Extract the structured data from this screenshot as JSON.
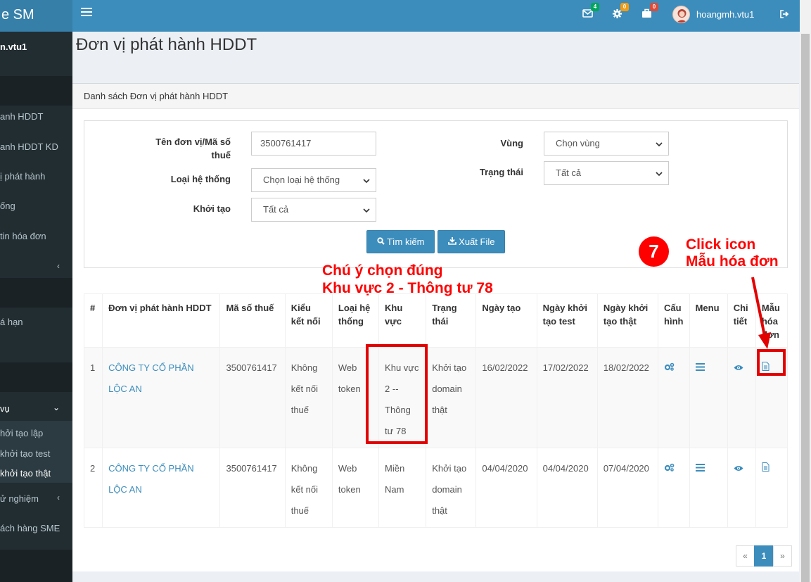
{
  "header": {
    "brand": "e SM",
    "user_name": "hoangmh.vtu1",
    "badges": {
      "mail": "4",
      "gear": "0",
      "briefcase": "0"
    },
    "badge_colors": {
      "mail": "#00a65a",
      "gear": "#f39c12",
      "briefcase": "#dd4b39"
    }
  },
  "sidebar": {
    "user": "n.vtu1",
    "items": [
      {
        "label": "anh HDDT"
      },
      {
        "label": "anh HDDT KD"
      },
      {
        "label": "ị phát hành"
      },
      {
        "label": "ống"
      },
      {
        "label": "tin hóa đơn"
      },
      {
        "label": "á hạn"
      },
      {
        "label": "vụ"
      },
      {
        "label": "hởi tạo lập"
      },
      {
        "label": "khởi tạo test"
      },
      {
        "label": "khởi tạo thật"
      },
      {
        "label": "ử nghiệm"
      },
      {
        "label": "ách hàng SME"
      }
    ]
  },
  "page": {
    "title": "Đơn vị phát hành HDDT",
    "box_title": "Danh sách Đơn vị phát hành HDDT"
  },
  "filter": {
    "tax_label": "Tên đơn vị/Mã số thuế",
    "tax_value": "3500761417",
    "system_label": "Loại hệ thống",
    "system_value": "Chọn loại hệ thống",
    "init_label": "Khởi tạo",
    "init_value": "Tất cả",
    "region_label": "Vùng",
    "region_value": "Chọn vùng",
    "status_label": "Trạng thái",
    "status_value": "Tất cả",
    "search_button": "Tìm kiếm",
    "export_button": "Xuất File"
  },
  "table": {
    "headers": [
      "#",
      "Đơn vị phát hành HDDT",
      "Mã số thuế",
      "Kiểu kết nối",
      "Loại hệ thống",
      "Khu vực",
      "Trạng thái",
      "Ngày tạo",
      "Ngày khởi tạo test",
      "Ngày khởi tạo thật",
      "Cấu hình",
      "Menu",
      "Chi tiết",
      "Mẫu hóa đơn"
    ],
    "rows": [
      {
        "num": "1",
        "name": "CÔNG TY CỔ PHẦN LỘC AN",
        "tax": "3500761417",
        "conn": "Không kết nối thuế",
        "system": "Web token",
        "region": "Khu vực 2 -- Thông tư 78",
        "status": "Khởi tạo domain thật",
        "created": "16/02/2022",
        "test_date": "17/02/2022",
        "real_date": "18/02/2022"
      },
      {
        "num": "2",
        "name": "CÔNG TY CỔ PHẦN LỘC AN",
        "tax": "3500761417",
        "conn": "Không kết nối thuế",
        "system": "Web token",
        "region": "Miền Nam",
        "status": "Khởi tạo domain thật",
        "created": "04/04/2020",
        "test_date": "04/04/2020",
        "real_date": "07/04/2020"
      }
    ]
  },
  "pagination": {
    "prev": "«",
    "current": "1",
    "next": "»"
  },
  "annotations": {
    "note_line1": "Chú ý chọn đúng",
    "note_line2": "Khu vực 2 - Thông tư 78",
    "step": "7",
    "click_line1": "Click icon",
    "click_line2": "Mẫu hóa đơn"
  }
}
